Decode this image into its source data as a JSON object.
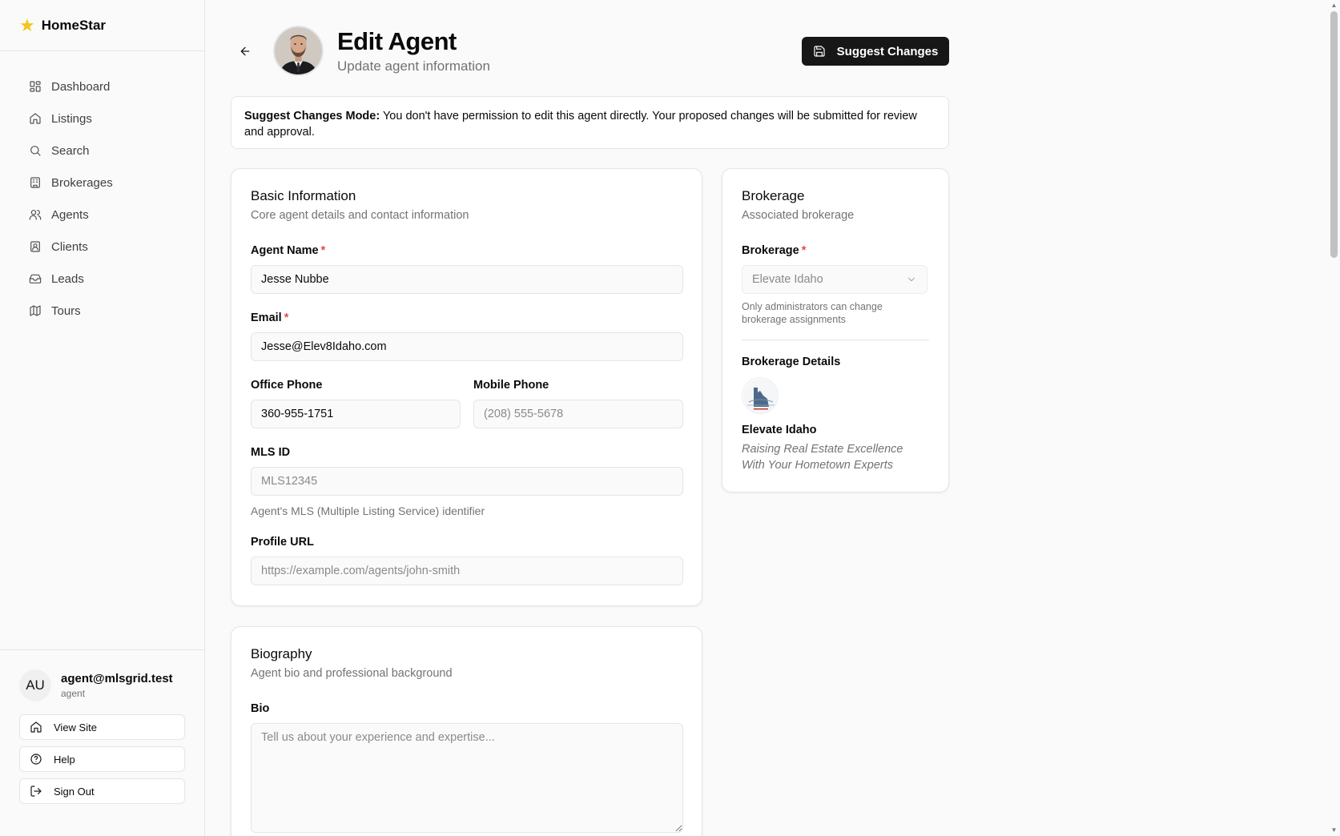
{
  "app": {
    "name": "HomeStar",
    "logo_icon": "star-icon",
    "accent": "#f5c518"
  },
  "sidebar": {
    "items": [
      {
        "label": "Dashboard",
        "icon": "layout-grid-icon"
      },
      {
        "label": "Listings",
        "icon": "home-icon"
      },
      {
        "label": "Search",
        "icon": "search-icon"
      },
      {
        "label": "Brokerages",
        "icon": "building-icon"
      },
      {
        "label": "Agents",
        "icon": "users-icon"
      },
      {
        "label": "Clients",
        "icon": "contact-icon"
      },
      {
        "label": "Leads",
        "icon": "inbox-icon"
      },
      {
        "label": "Tours",
        "icon": "map-icon"
      }
    ],
    "user": {
      "initials": "AU",
      "email": "agent@mlsgrid.test",
      "role": "agent"
    },
    "footer_buttons": [
      {
        "label": "View Site",
        "icon": "home-icon"
      },
      {
        "label": "Help",
        "icon": "help-circle-icon"
      },
      {
        "label": "Sign Out",
        "icon": "log-out-icon"
      }
    ]
  },
  "header": {
    "title": "Edit Agent",
    "subtitle": "Update agent information",
    "suggest_button": "Suggest Changes"
  },
  "alert": {
    "bold": "Suggest Changes Mode:",
    "text": " You don't have permission to edit this agent directly. Your proposed changes will be submitted for review and approval."
  },
  "basic_info": {
    "title": "Basic Information",
    "description": "Core agent details and contact information",
    "agent_name": {
      "label": "Agent Name",
      "value": "Jesse Nubbe"
    },
    "email": {
      "label": "Email",
      "value": "Jesse@Elev8Idaho.com"
    },
    "office_phone": {
      "label": "Office Phone",
      "value": "360-955-1751"
    },
    "mobile_phone": {
      "label": "Mobile Phone",
      "value": "",
      "placeholder": "(208) 555-5678"
    },
    "mls_id": {
      "label": "MLS ID",
      "value": "",
      "placeholder": "MLS12345",
      "help": "Agent's MLS (Multiple Listing Service) identifier"
    },
    "profile_url": {
      "label": "Profile URL",
      "value": "",
      "placeholder": "https://example.com/agents/john-smith"
    }
  },
  "biography": {
    "title": "Biography",
    "description": "Agent bio and professional background",
    "bio": {
      "label": "Bio",
      "value": "",
      "placeholder": "Tell us about your experience and expertise..."
    }
  },
  "brokerage": {
    "title": "Brokerage",
    "description": "Associated brokerage",
    "select_label": "Brokerage",
    "selected": "Elevate Idaho",
    "help": "Only administrators can change brokerage assignments",
    "details_label": "Brokerage Details",
    "name": "Elevate Idaho",
    "tagline": "Raising Real Estate Excellence With Your Hometown Experts"
  }
}
